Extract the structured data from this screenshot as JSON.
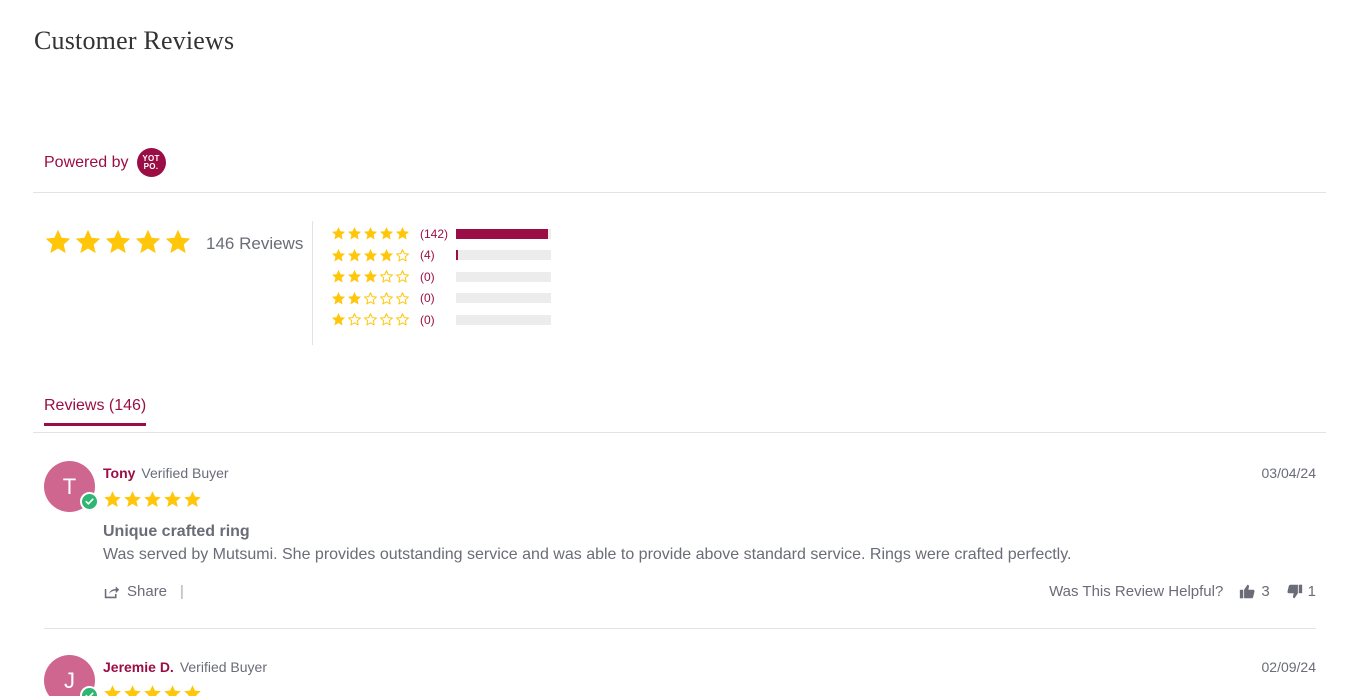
{
  "page": {
    "title": "Customer Reviews"
  },
  "powered": {
    "label": "Powered by",
    "logo_text_line1": "YOT",
    "logo_text_line2": "PO."
  },
  "summary": {
    "average_rating": 5,
    "total_label": "146 Reviews"
  },
  "distribution": [
    {
      "stars": 5,
      "count_label": "(142)",
      "count": 142
    },
    {
      "stars": 4,
      "count_label": "(4)",
      "count": 4
    },
    {
      "stars": 3,
      "count_label": "(0)",
      "count": 0
    },
    {
      "stars": 2,
      "count_label": "(0)",
      "count": 0
    },
    {
      "stars": 1,
      "count_label": "(0)",
      "count": 0
    }
  ],
  "tabs": {
    "reviews_label": "Reviews (146)"
  },
  "reviews": [
    {
      "initial": "T",
      "name": "Tony",
      "verified": "Verified Buyer",
      "date": "03/04/24",
      "rating": 5,
      "title": "Unique crafted ring",
      "body": "Was served by Mutsumi. She provides outstanding service and was able to provide above standard service. Rings were crafted perfectly.",
      "share_label": "Share",
      "pipe": "|",
      "helpful_question": "Was This Review Helpful?",
      "votes_up": "3",
      "votes_down": "1"
    },
    {
      "initial": "J",
      "name": "Jeremie D.",
      "verified": "Verified Buyer",
      "date": "02/09/24",
      "rating": 5
    }
  ],
  "colors": {
    "accent": "#9b0e45",
    "star": "#ffc60a",
    "avatar": "#cf6690",
    "verified": "#2fb673",
    "text": "#6a6c77"
  }
}
